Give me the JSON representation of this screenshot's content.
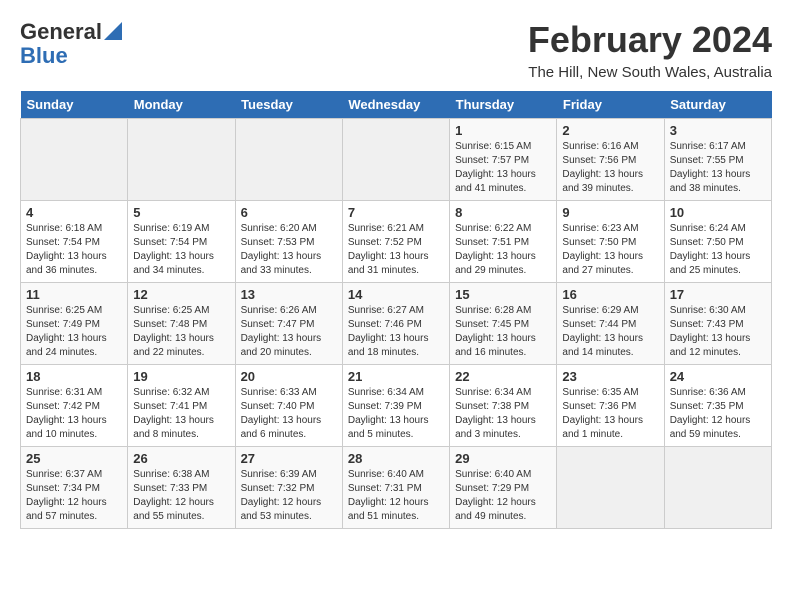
{
  "logo": {
    "general": "General",
    "blue": "Blue"
  },
  "header": {
    "title": "February 2024",
    "subtitle": "The Hill, New South Wales, Australia"
  },
  "weekdays": [
    "Sunday",
    "Monday",
    "Tuesday",
    "Wednesday",
    "Thursday",
    "Friday",
    "Saturday"
  ],
  "weeks": [
    [
      {
        "day": "",
        "info": ""
      },
      {
        "day": "",
        "info": ""
      },
      {
        "day": "",
        "info": ""
      },
      {
        "day": "",
        "info": ""
      },
      {
        "day": "1",
        "info": "Sunrise: 6:15 AM\nSunset: 7:57 PM\nDaylight: 13 hours\nand 41 minutes."
      },
      {
        "day": "2",
        "info": "Sunrise: 6:16 AM\nSunset: 7:56 PM\nDaylight: 13 hours\nand 39 minutes."
      },
      {
        "day": "3",
        "info": "Sunrise: 6:17 AM\nSunset: 7:55 PM\nDaylight: 13 hours\nand 38 minutes."
      }
    ],
    [
      {
        "day": "4",
        "info": "Sunrise: 6:18 AM\nSunset: 7:54 PM\nDaylight: 13 hours\nand 36 minutes."
      },
      {
        "day": "5",
        "info": "Sunrise: 6:19 AM\nSunset: 7:54 PM\nDaylight: 13 hours\nand 34 minutes."
      },
      {
        "day": "6",
        "info": "Sunrise: 6:20 AM\nSunset: 7:53 PM\nDaylight: 13 hours\nand 33 minutes."
      },
      {
        "day": "7",
        "info": "Sunrise: 6:21 AM\nSunset: 7:52 PM\nDaylight: 13 hours\nand 31 minutes."
      },
      {
        "day": "8",
        "info": "Sunrise: 6:22 AM\nSunset: 7:51 PM\nDaylight: 13 hours\nand 29 minutes."
      },
      {
        "day": "9",
        "info": "Sunrise: 6:23 AM\nSunset: 7:50 PM\nDaylight: 13 hours\nand 27 minutes."
      },
      {
        "day": "10",
        "info": "Sunrise: 6:24 AM\nSunset: 7:50 PM\nDaylight: 13 hours\nand 25 minutes."
      }
    ],
    [
      {
        "day": "11",
        "info": "Sunrise: 6:25 AM\nSunset: 7:49 PM\nDaylight: 13 hours\nand 24 minutes."
      },
      {
        "day": "12",
        "info": "Sunrise: 6:25 AM\nSunset: 7:48 PM\nDaylight: 13 hours\nand 22 minutes."
      },
      {
        "day": "13",
        "info": "Sunrise: 6:26 AM\nSunset: 7:47 PM\nDaylight: 13 hours\nand 20 minutes."
      },
      {
        "day": "14",
        "info": "Sunrise: 6:27 AM\nSunset: 7:46 PM\nDaylight: 13 hours\nand 18 minutes."
      },
      {
        "day": "15",
        "info": "Sunrise: 6:28 AM\nSunset: 7:45 PM\nDaylight: 13 hours\nand 16 minutes."
      },
      {
        "day": "16",
        "info": "Sunrise: 6:29 AM\nSunset: 7:44 PM\nDaylight: 13 hours\nand 14 minutes."
      },
      {
        "day": "17",
        "info": "Sunrise: 6:30 AM\nSunset: 7:43 PM\nDaylight: 13 hours\nand 12 minutes."
      }
    ],
    [
      {
        "day": "18",
        "info": "Sunrise: 6:31 AM\nSunset: 7:42 PM\nDaylight: 13 hours\nand 10 minutes."
      },
      {
        "day": "19",
        "info": "Sunrise: 6:32 AM\nSunset: 7:41 PM\nDaylight: 13 hours\nand 8 minutes."
      },
      {
        "day": "20",
        "info": "Sunrise: 6:33 AM\nSunset: 7:40 PM\nDaylight: 13 hours\nand 6 minutes."
      },
      {
        "day": "21",
        "info": "Sunrise: 6:34 AM\nSunset: 7:39 PM\nDaylight: 13 hours\nand 5 minutes."
      },
      {
        "day": "22",
        "info": "Sunrise: 6:34 AM\nSunset: 7:38 PM\nDaylight: 13 hours\nand 3 minutes."
      },
      {
        "day": "23",
        "info": "Sunrise: 6:35 AM\nSunset: 7:36 PM\nDaylight: 13 hours\nand 1 minute."
      },
      {
        "day": "24",
        "info": "Sunrise: 6:36 AM\nSunset: 7:35 PM\nDaylight: 12 hours\nand 59 minutes."
      }
    ],
    [
      {
        "day": "25",
        "info": "Sunrise: 6:37 AM\nSunset: 7:34 PM\nDaylight: 12 hours\nand 57 minutes."
      },
      {
        "day": "26",
        "info": "Sunrise: 6:38 AM\nSunset: 7:33 PM\nDaylight: 12 hours\nand 55 minutes."
      },
      {
        "day": "27",
        "info": "Sunrise: 6:39 AM\nSunset: 7:32 PM\nDaylight: 12 hours\nand 53 minutes."
      },
      {
        "day": "28",
        "info": "Sunrise: 6:40 AM\nSunset: 7:31 PM\nDaylight: 12 hours\nand 51 minutes."
      },
      {
        "day": "29",
        "info": "Sunrise: 6:40 AM\nSunset: 7:29 PM\nDaylight: 12 hours\nand 49 minutes."
      },
      {
        "day": "",
        "info": ""
      },
      {
        "day": "",
        "info": ""
      }
    ]
  ]
}
